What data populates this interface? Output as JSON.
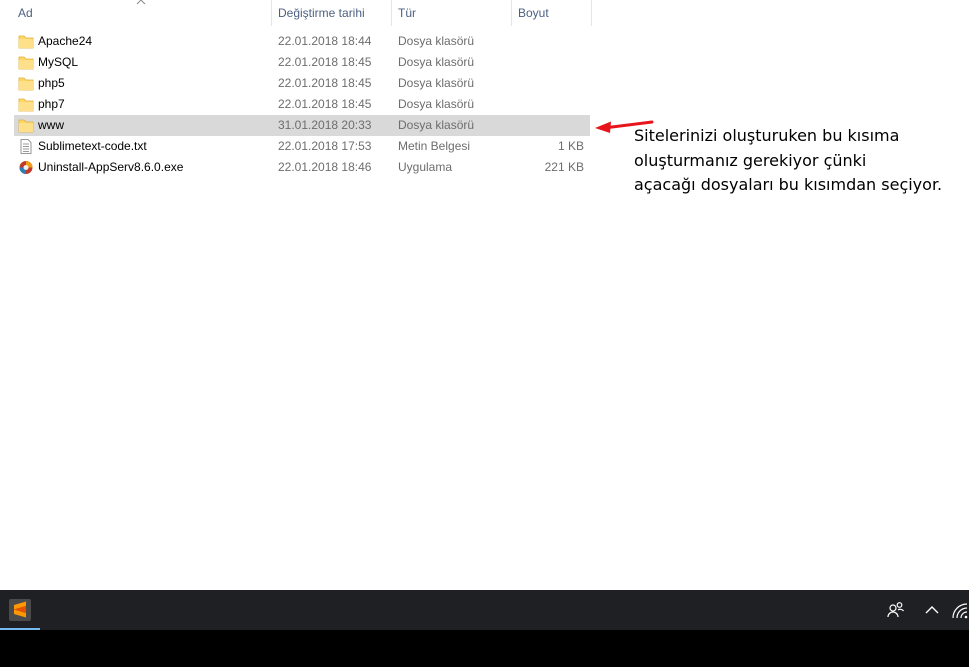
{
  "columns": {
    "name": "Ad",
    "modified": "Değiştirme tarihi",
    "type": "Tür",
    "size": "Boyut"
  },
  "files": [
    {
      "name": "Apache24",
      "modified": "22.01.2018 18:44",
      "type": "Dosya klasörü",
      "size": "",
      "icon": "folder-icon",
      "selected": false
    },
    {
      "name": "MySQL",
      "modified": "22.01.2018 18:45",
      "type": "Dosya klasörü",
      "size": "",
      "icon": "folder-icon",
      "selected": false
    },
    {
      "name": "php5",
      "modified": "22.01.2018 18:45",
      "type": "Dosya klasörü",
      "size": "",
      "icon": "folder-icon",
      "selected": false
    },
    {
      "name": "php7",
      "modified": "22.01.2018 18:45",
      "type": "Dosya klasörü",
      "size": "",
      "icon": "folder-icon",
      "selected": false
    },
    {
      "name": "www",
      "modified": "31.01.2018 20:33",
      "type": "Dosya klasörü",
      "size": "",
      "icon": "folder-icon",
      "selected": true
    },
    {
      "name": "Sublimetext-code.txt",
      "modified": "22.01.2018 17:53",
      "type": "Metin Belgesi",
      "size": "1 KB",
      "icon": "text-file-icon",
      "selected": false
    },
    {
      "name": "Uninstall-AppServ8.6.0.exe",
      "modified": "22.01.2018 18:46",
      "type": "Uygulama",
      "size": "221 KB",
      "icon": "app-exe-icon",
      "selected": false
    }
  ],
  "annotation": {
    "lines": [
      "Sitelerinizi oluşturuken bu kısıma",
      "oluşturmanız gerekiyor çünki",
      "açacağı dosyaları bu kısımdan seçiyor."
    ],
    "arrow_color": "#e8141b"
  },
  "taskbar": {
    "apps": [
      {
        "icon": "sublime-text-icon",
        "active": true
      }
    ],
    "tray": [
      "people-icon",
      "chevron-up-icon",
      "wifi-icon"
    ]
  },
  "colors": {
    "header_text": "#4d6082",
    "selected_row": "#d9d9d9",
    "taskbar": "#1f2023",
    "folder": "#ffd766"
  }
}
